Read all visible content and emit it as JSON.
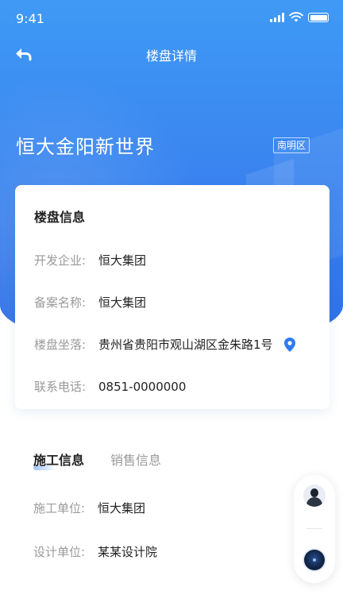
{
  "status_bar": {
    "time": "9:41"
  },
  "nav": {
    "title": "楼盘详情"
  },
  "project": {
    "name": "恒大金阳新世界",
    "district": "南明区"
  },
  "info_card": {
    "title": "楼盘信息",
    "rows": [
      {
        "label": "开发企业:",
        "value": "恒大集团"
      },
      {
        "label": "备案名称:",
        "value": "恒大集团"
      },
      {
        "label": "楼盘坐落:",
        "value": "贵州省贵阳市观山湖区金朱路1号"
      },
      {
        "label": "联系电话:",
        "value": "0851-0000000"
      }
    ]
  },
  "tabs": [
    {
      "label": "施工信息",
      "active": true
    },
    {
      "label": "销售信息",
      "active": false
    }
  ],
  "construction": [
    {
      "label": "施工单位:",
      "value": "恒大集团"
    },
    {
      "label": "设计单位:",
      "value": "某某设计院"
    }
  ],
  "colors": {
    "primary": "#3a86f0",
    "label_gray": "#9a9a9a",
    "text": "#222222"
  },
  "icons": [
    "back-arrow-icon",
    "signal-icon",
    "wifi-icon",
    "battery-icon",
    "location-pin-icon",
    "avatar-icon",
    "ai-assistant-icon"
  ]
}
